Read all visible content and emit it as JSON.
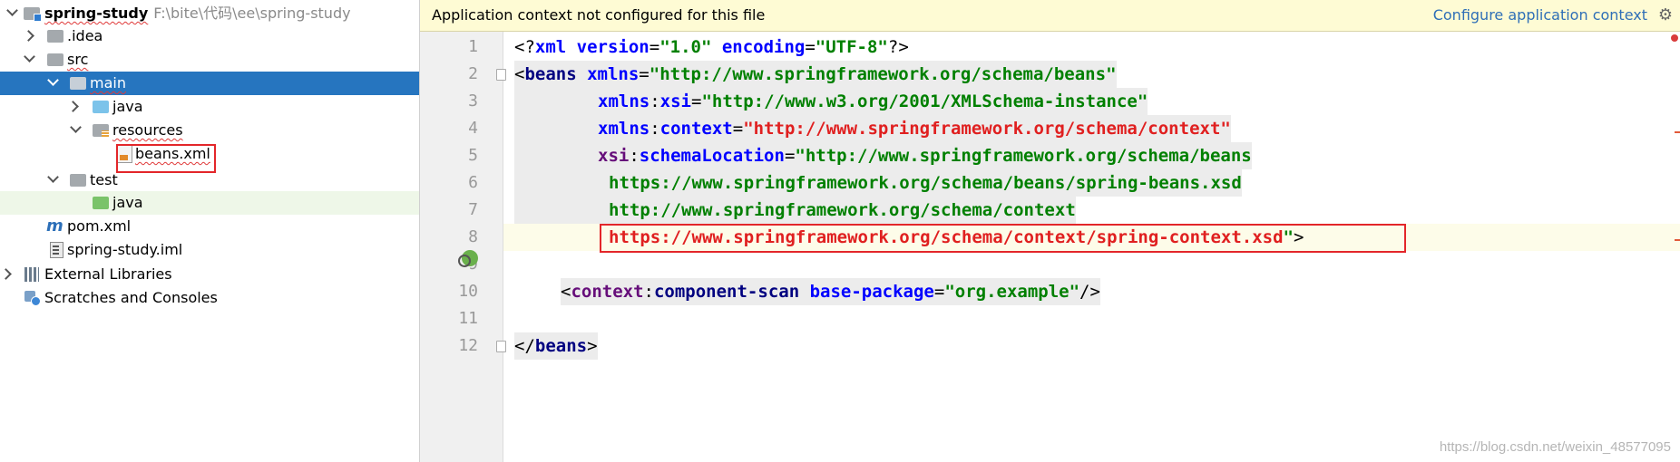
{
  "tree": {
    "project": {
      "name": "spring-study",
      "path": "F:\\bite\\代码\\ee\\spring-study"
    },
    "items": [
      {
        "label": ".idea"
      },
      {
        "label": "src"
      },
      {
        "label": "main"
      },
      {
        "label": "java"
      },
      {
        "label": "resources"
      },
      {
        "label": "beans.xml"
      },
      {
        "label": "test"
      },
      {
        "label": "java"
      },
      {
        "label": "pom.xml"
      },
      {
        "label": "spring-study.iml"
      },
      {
        "label": "External Libraries"
      },
      {
        "label": "Scratches and Consoles"
      }
    ]
  },
  "editor": {
    "banner": {
      "message": "Application context not configured for this file",
      "action": "Configure application context"
    },
    "line_numbers": [
      "1",
      "2",
      "3",
      "4",
      "5",
      "6",
      "7",
      "8",
      "9",
      "10",
      "11",
      "12"
    ],
    "code": {
      "l1": {
        "a": "<?",
        "b": "xml ",
        "c": "version",
        "d": "=",
        "e": "\"1.0\"",
        "f": " encoding",
        "g": "=",
        "h": "\"UTF-8\"",
        "i": "?>"
      },
      "l2": {
        "a": "<",
        "b": "beans",
        "c": " xmlns",
        "d": "=",
        "e": "\"http://www.springframework.org/schema/beans\""
      },
      "l3": {
        "a": "xmlns",
        "b": ":",
        "c": "xsi",
        "d": "=",
        "e": "\"http://www.w3.org/2001/XMLSchema-instance\""
      },
      "l4": {
        "a": "xmlns",
        "b": ":",
        "c": "context",
        "d": "=",
        "e": "\"http://www.springframework.org/schema/context\""
      },
      "l5": {
        "a": "xsi",
        "b": ":",
        "c": "schemaLocation",
        "d": "=",
        "e": "\"http://www.springframework.org/schema/beans"
      },
      "l6": {
        "a": "https://www.springframework.org/schema/beans/spring-beans.xsd"
      },
      "l7": {
        "a": "http://www.springframework.org/schema/context"
      },
      "l8": {
        "a": "https://www.springframework.org/schema/context/spring-context.xsd",
        "b": "\"",
        "c": ">"
      },
      "l10": {
        "a": "<",
        "b": "context",
        "c": ":",
        "d": "component-scan",
        "e": " base-package",
        "f": "=",
        "g": "\"org.example\"",
        "h": "/>"
      },
      "l12": {
        "a": "</",
        "b": "beans",
        "c": ">"
      }
    }
  },
  "watermark": "https://blog.csdn.net/weixin_48577095"
}
